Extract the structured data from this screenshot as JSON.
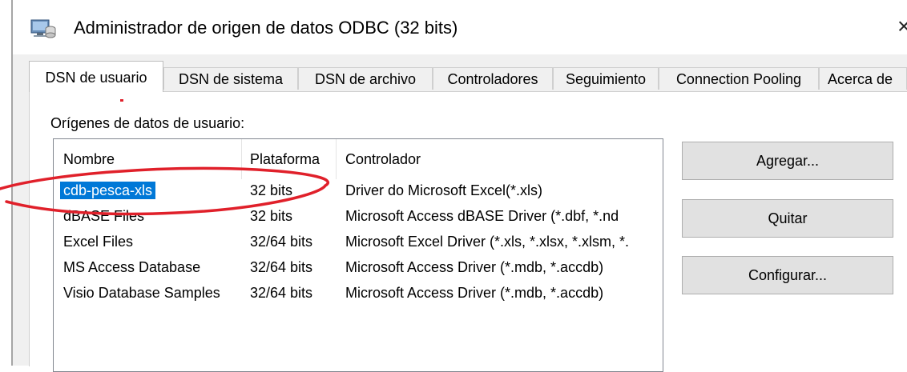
{
  "window": {
    "title": "Administrador de origen de datos ODBC (32 bits)",
    "close_glyph": "×"
  },
  "tabs": [
    {
      "label": "DSN de usuario",
      "active": true
    },
    {
      "label": "DSN de sistema",
      "active": false
    },
    {
      "label": "DSN de archivo",
      "active": false
    },
    {
      "label": "Controladores",
      "active": false
    },
    {
      "label": "Seguimiento",
      "active": false
    },
    {
      "label": "Connection Pooling",
      "active": false
    },
    {
      "label": "Acerca de",
      "active": false
    }
  ],
  "section_label": "Orígenes de datos de usuario:",
  "table": {
    "headers": [
      "Nombre",
      "Plataforma",
      "Controlador"
    ],
    "rows": [
      {
        "nombre": "cdb-pesca-xls",
        "plataforma": "32 bits",
        "controlador": "Driver do Microsoft Excel(*.xls)",
        "selected": true
      },
      {
        "nombre": "dBASE Files",
        "plataforma": "32 bits",
        "controlador": "Microsoft Access dBASE Driver (*.dbf, *.nd"
      },
      {
        "nombre": "Excel Files",
        "plataforma": "32/64 bits",
        "controlador": "Microsoft Excel Driver (*.xls, *.xlsx, *.xlsm, *."
      },
      {
        "nombre": "MS Access Database",
        "plataforma": "32/64 bits",
        "controlador": "Microsoft Access Driver (*.mdb, *.accdb)"
      },
      {
        "nombre": "Visio Database Samples",
        "plataforma": "32/64 bits",
        "controlador": "Microsoft Access Driver (*.mdb, *.accdb)"
      }
    ]
  },
  "buttons": {
    "add": "Agregar...",
    "remove": "Quitar",
    "configure": "Configurar..."
  },
  "colors": {
    "selection": "#0078d7",
    "annotation": "#e0202a"
  }
}
